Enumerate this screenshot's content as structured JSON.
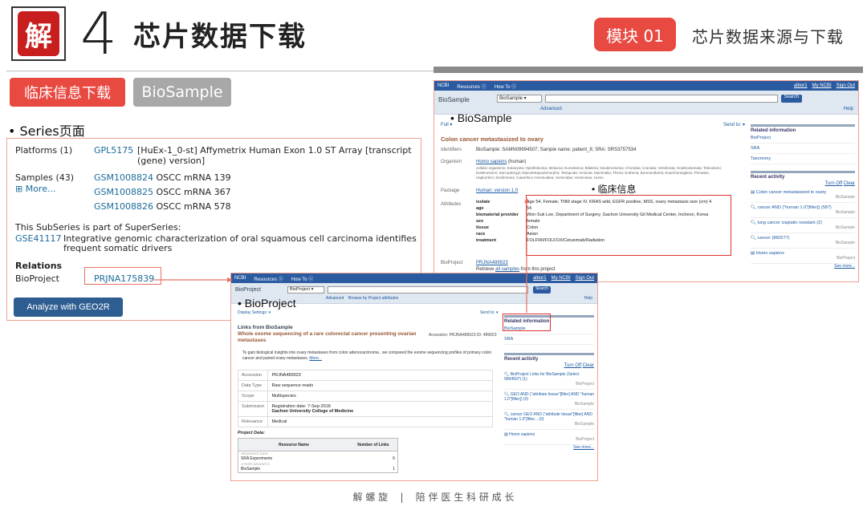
{
  "header": {
    "logo_char": "解",
    "chapter_number": "4",
    "chapter_title": "芯片数据下载",
    "module_label": "模块 01",
    "module_title": "芯片数据来源与下载"
  },
  "tabs": {
    "clinical": "临床信息下载",
    "biosample": "BioSample"
  },
  "series": {
    "bullet_label": "• Series页面",
    "platforms_label": "Platforms (1)",
    "platform_id": "GPL5175",
    "platform_desc_1": "[HuEx-1_0-st] Affymetrix Human Exon 1.0 ST Array [transcript",
    "platform_desc_2": "(gene) version]",
    "samples_label": "Samples (43)",
    "more_label": "⊞ More...",
    "samples": [
      {
        "id": "GSM1008824",
        "desc": "OSCC mRNA 139"
      },
      {
        "id": "GSM1008825",
        "desc": "OSCC mRNA 367"
      },
      {
        "id": "GSM1008826",
        "desc": "OSCC mRNA 578"
      }
    ],
    "superseries_note": "This SubSeries is part of SuperSeries:",
    "superseries_id": "GSE41117",
    "superseries_desc_1": "Integrative genomic characterization of oral squamous cell carcinoma identifies",
    "superseries_desc_2": "frequent somatic drivers",
    "relations_label": "Relations",
    "bioproject_label": "BioProject",
    "bioproject_id": "PRJNA175839",
    "analyze_button": "Analyze with GEO2R"
  },
  "biosample_win": {
    "nav": {
      "logo": "NCBI",
      "resources": "Resources ⓥ",
      "howto": "How To ⓥ",
      "user": "albor1",
      "my_ncbi": "My NCBI",
      "sign_out": "Sign Out"
    },
    "db_label": "BioSample",
    "db_select": "BioSample",
    "search_button": "Search",
    "advanced": "Advanced",
    "help": "Help",
    "overlay_label": "• BioSample",
    "full_label": "Full ▾",
    "send_to": "Send to: ▾",
    "title": "Colon cancer metastasized to ovary",
    "identifiers_label": "Identifiers",
    "identifiers_value": "BioSample: SAMN09994507; Sample name: patient_8; SRA: SRS3757534",
    "organism_label": "Organism",
    "organism_link": "Homo sapiens",
    "organism_suffix": " (human)",
    "lineage_1": "cellular organisms; Eukaryota; Opisthokonta; Metazoa; Eumetazoa; Bilateria; Deuterostomia; Chordata; Craniata; Vertebrata; Gnathostomata; Teleostomi;",
    "lineage_2": "Euteleostomi; Sarcopterygii; Dipnotetrapodomorpha; Tetrapoda; Amniota; Mammalia; Theria; Eutheria; Boreoeutheria; Euarchontoglires; Primates;",
    "lineage_3": "Haplorrhini; Simiiformes; Catarrhini; Hominoidea; Hominidae; Homininae; Homo",
    "package_label": "Package",
    "package_value": "Human; version 1.0",
    "clinical_label": "• 临床信息",
    "attributes_label": "Attributes",
    "attributes": [
      {
        "k": "isolate",
        "v": "Age 54, Female, TNM stage IV, KRAS wild, EGFR positive, MSS, ovary metastasis size (cm) 4"
      },
      {
        "k": "age",
        "v": "54"
      },
      {
        "k": "biomaterial provider",
        "v": "Won-Suk Lee, Department of Surgery, Gachon University Gil Medical Center, Incheon, Korea"
      },
      {
        "k": "sex",
        "v": "female"
      },
      {
        "k": "tissue",
        "v": "Colon"
      },
      {
        "k": "race",
        "v": "Asian"
      },
      {
        "k": "treatment",
        "v": "FOLFIRI/FOLFOX/Cetuximab/Radiation"
      }
    ],
    "bioproject_label": "BioProject",
    "bioproject_id": "PRJNA489923",
    "retrieve_prefix": "Retrieve ",
    "retrieve_link": "all samples",
    "retrieve_suffix": " from this project",
    "related_head": "Related information",
    "related": [
      "BioProject",
      "SRA",
      "Taxonomy"
    ],
    "recent_head": "Recent activity",
    "turn_off": "Turn Off",
    "clear": "Clear",
    "recent": [
      {
        "text": "Colon cancer metastasized to ovary",
        "db": "BioSample"
      },
      {
        "text": "cancer AND (\"human 1.0\"[filter]) (587)",
        "db": "BioSample"
      },
      {
        "text": "lung cancer cisplatin resistant (2)",
        "db": "BioSample"
      },
      {
        "text": "cancer (860277)",
        "db": "BioSample"
      },
      {
        "text": "Homo sapiens",
        "db": "BioProject"
      }
    ],
    "see_more": "See more..."
  },
  "bioproject_win": {
    "nav": {
      "logo": "NCBI",
      "resources": "Resources ⓥ",
      "howto": "How To ⓥ",
      "user": "albor1",
      "my_ncbi": "My NCBI",
      "sign_out": "Sign Out"
    },
    "db_label": "BioProject",
    "db_select": "BioProject",
    "search_button": "Search",
    "advanced": "Advanced",
    "browse": "Browse by Project attributes",
    "help": "Help",
    "overlay_label": "• BioProject",
    "display_settings": "Display Settings: ▾",
    "send_to": "Send to: ▾",
    "links_from": "Links from BioSample",
    "title": "Whole exome sequencing of a rare colorectal cancer presenting ovarian metastases",
    "accession_line": "Accession: PRJNA489923   ID: 489923",
    "description": "To gain biological insights into ovary metastases from colon adenocarcinoma , we compared the exome sequencing profiles of primary colon cancer and paired ovary metastases.",
    "more": "More...",
    "meta": [
      {
        "k": "Accession",
        "v": "PRJNA489923"
      },
      {
        "k": "Data Type",
        "v": "Raw sequence reads"
      },
      {
        "k": "Scope",
        "v": "Multispecies"
      },
      {
        "k": "Submission",
        "v": "Registration date: 7-Sep-2018",
        "v2": "Gachon University College of Medicine"
      },
      {
        "k": "Relevance",
        "v": "Medical"
      }
    ],
    "project_data": "Project Data:",
    "col_resource": "Resource Name",
    "col_links": "Number of Links",
    "seq_data": "SEQUENCE DATA",
    "sra_row": "SRA Experiments",
    "sra_count": "6",
    "other": "OTHER DATASETS",
    "biosample_row": "BioSample",
    "biosample_count": "1",
    "related_head": "Related information",
    "related": [
      "BioSample",
      "SRA"
    ],
    "recent_head": "Recent activity",
    "turn_off": "Turn Off",
    "clear": "Clear",
    "recent": [
      {
        "text": "BioProject Links for BioSample (Select 9994507) (1)",
        "db": "BioProject"
      },
      {
        "text": "GEO AND (\"attribute tissue\"[filter] AND \"human 1.0\"[filter]) (0)",
        "db": "BioSample"
      },
      {
        "text": "cancer GEO AND (\"attribute tissue\"[filter] AND \"human 1.0\"[filter... (0)",
        "db": "BioSample"
      },
      {
        "text": "Homo sapiens",
        "db": "BioProject"
      }
    ],
    "see_more": "See more..."
  },
  "footer": {
    "left": "解 螺 旋",
    "sep": "|",
    "right": "陪 伴 医 生 科 研 成 长"
  },
  "colors": {
    "accent": "#e84a42",
    "ncbi_blue": "#2a5aa0",
    "link": "#1b5aa0"
  }
}
